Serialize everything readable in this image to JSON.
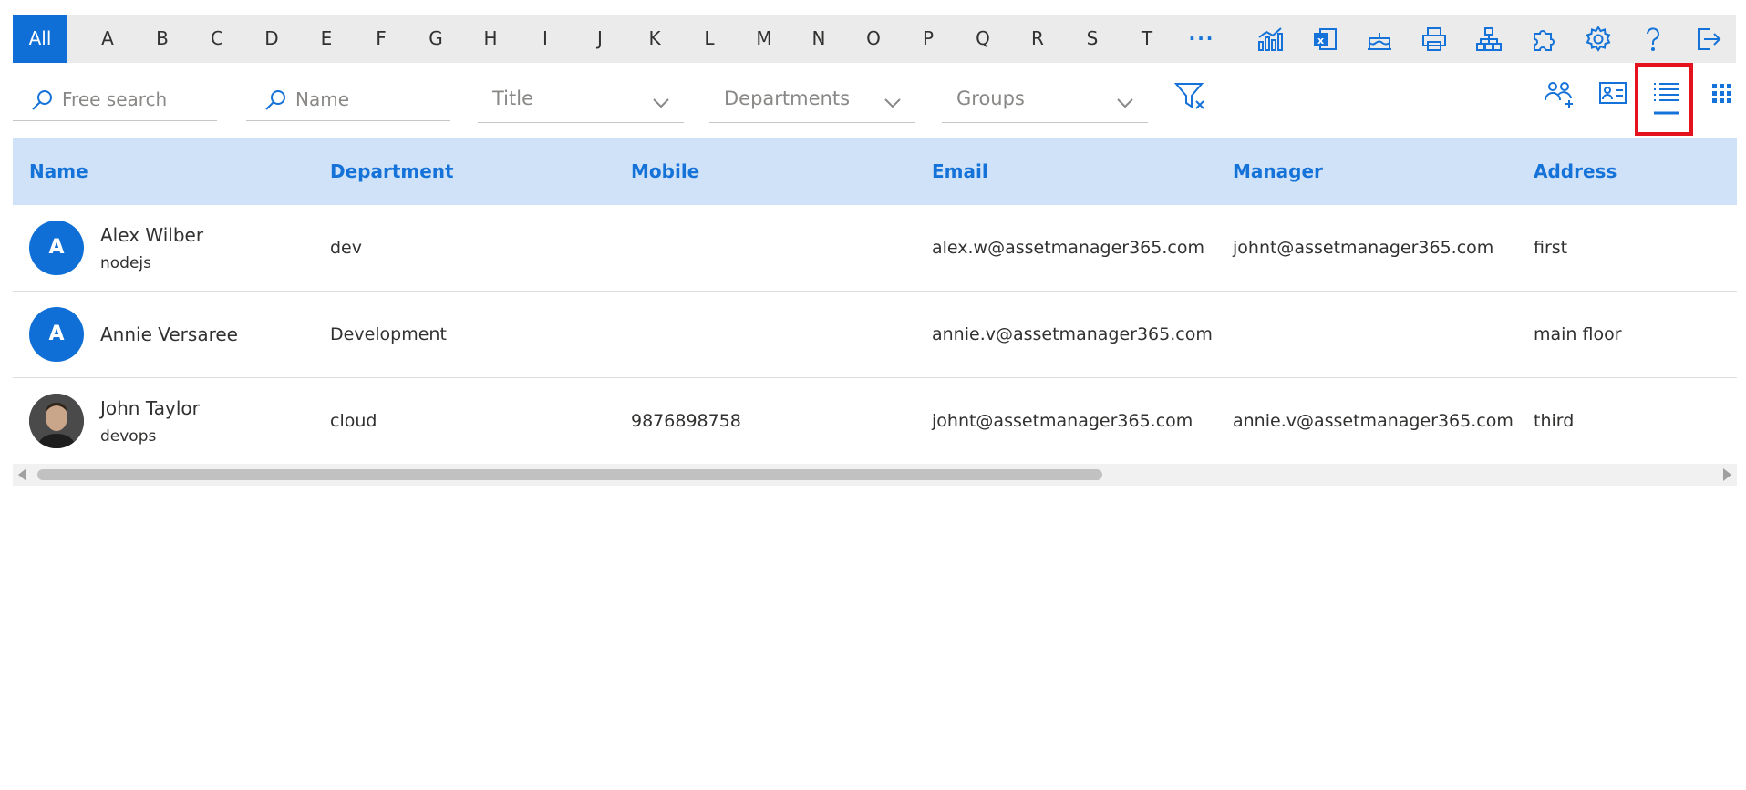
{
  "alphabet": {
    "all": "All",
    "letters": [
      "A",
      "B",
      "C",
      "D",
      "E",
      "F",
      "G",
      "H",
      "I",
      "J",
      "K",
      "L",
      "M",
      "N",
      "O",
      "P",
      "Q",
      "R",
      "S",
      "T"
    ],
    "more": "···"
  },
  "toolbar_icons": [
    "analytics-icon",
    "excel-export-icon",
    "birthday-cake-icon",
    "print-icon",
    "org-chart-icon",
    "puzzle-icon",
    "settings-icon",
    "help-icon",
    "sign-out-icon"
  ],
  "filters": {
    "free_search_placeholder": "Free search",
    "name_placeholder": "Name",
    "title": "Title",
    "departments": "Departments",
    "groups": "Groups"
  },
  "view_icons": [
    "add-people-icon",
    "contact-card-icon",
    "list-view-icon",
    "grid-view-icon"
  ],
  "table": {
    "columns": [
      "Name",
      "Department",
      "Mobile",
      "Email",
      "Manager",
      "Address"
    ],
    "rows": [
      {
        "initial": "A",
        "name": "Alex Wilber",
        "subtitle": "nodejs",
        "department": "dev",
        "mobile": "",
        "email": "alex.w@assetmanager365.com",
        "manager": "johnt@assetmanager365.com",
        "address": "first"
      },
      {
        "initial": "A",
        "name": "Annie Versaree",
        "subtitle": "",
        "department": "Development",
        "mobile": "",
        "email": "annie.v@assetmanager365.com",
        "manager": "",
        "address": "main floor"
      },
      {
        "initial": "",
        "name": "John Taylor",
        "subtitle": "devops",
        "department": "cloud",
        "mobile": "9876898758",
        "email": "johnt@assetmanager365.com",
        "manager": "annie.v@assetmanager365.com",
        "address": "third"
      }
    ]
  },
  "colors": {
    "accent": "#0f6fd6",
    "header_bg": "#cfe2f7",
    "highlight": "#e3121d"
  }
}
